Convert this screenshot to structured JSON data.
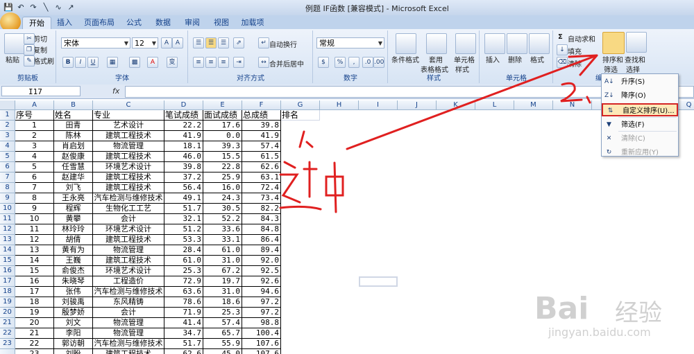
{
  "window": {
    "title": "例题 IF函数 [兼容模式] - Microsoft Excel",
    "qat_icons": [
      "save-icon",
      "undo-icon",
      "redo-icon",
      "line-icon",
      "zigzag-icon",
      "arrow-icon"
    ]
  },
  "tabs": [
    "开始",
    "插入",
    "页面布局",
    "公式",
    "数据",
    "审阅",
    "视图",
    "加载项"
  ],
  "ribbon": {
    "clipboard": {
      "paste": "粘贴",
      "cut": "剪切",
      "copy": "复制",
      "format_painter": "格式刷",
      "label": "剪贴板"
    },
    "font": {
      "name": "宋体",
      "size": "12",
      "bold": "B",
      "italic": "I",
      "underline": "U",
      "color_a": "A",
      "wen": "变",
      "label": "字体"
    },
    "alignment": {
      "wrap": "自动换行",
      "merge": "合并后居中",
      "label": "对齐方式"
    },
    "number": {
      "format": "常规",
      "currency": "%",
      "comma": ",",
      "label": "数字"
    },
    "styles": {
      "cond": "条件格式",
      "table1": "套用",
      "table2": "表格格式",
      "cell1": "单元格",
      "cell2": "样式",
      "label": "样式"
    },
    "cells": {
      "insert": "插入",
      "delete": "删除",
      "format": "格式",
      "label": "单元格"
    },
    "editing": {
      "autosum": "自动求和",
      "fill": "填充",
      "clear": "清除",
      "sort1": "排序和",
      "sort2": "筛选",
      "find1": "查找和",
      "find2": "选择",
      "label": "编"
    }
  },
  "formula_bar": {
    "cell_ref": "I17",
    "fx": "fx",
    "formula": ""
  },
  "columns": [
    "A",
    "B",
    "C",
    "D",
    "E",
    "F",
    "G",
    "H",
    "I",
    "J",
    "K",
    "L",
    "M",
    "N",
    "O",
    "P",
    "Q"
  ],
  "headers": [
    "序号",
    "姓名",
    "专业",
    "笔试成绩",
    "面试成绩",
    "总成绩",
    "排名"
  ],
  "rows": [
    [
      "1",
      "田青",
      "艺术设计",
      "22.2",
      "17.6",
      "39.8"
    ],
    [
      "2",
      "陈林",
      "建筑工程技术",
      "41.9",
      "0.0",
      "41.9"
    ],
    [
      "3",
      "肖启划",
      "物流管理",
      "18.1",
      "39.3",
      "57.4"
    ],
    [
      "4",
      "赵俊康",
      "建筑工程技术",
      "46.0",
      "15.5",
      "61.5"
    ],
    [
      "5",
      "任雪慧",
      "环境艺术设计",
      "39.8",
      "22.8",
      "62.6"
    ],
    [
      "6",
      "赵建华",
      "建筑工程技术",
      "37.2",
      "25.9",
      "63.1"
    ],
    [
      "7",
      "刘飞",
      "建筑工程技术",
      "56.4",
      "16.0",
      "72.4"
    ],
    [
      "8",
      "王永亮",
      "汽车检测与维修技术",
      "49.1",
      "24.3",
      "73.4"
    ],
    [
      "9",
      "程辉",
      "生物化工工艺",
      "51.7",
      "30.5",
      "82.2"
    ],
    [
      "10",
      "黄攀",
      "会计",
      "32.1",
      "52.2",
      "84.3"
    ],
    [
      "11",
      "林玲玲",
      "环境艺术设计",
      "51.2",
      "33.6",
      "84.8"
    ],
    [
      "12",
      "胡倩",
      "建筑工程技术",
      "53.3",
      "33.1",
      "86.4"
    ],
    [
      "13",
      "黄有为",
      "物流管理",
      "28.4",
      "61.0",
      "89.4"
    ],
    [
      "14",
      "王巍",
      "建筑工程技术",
      "61.0",
      "31.0",
      "92.0"
    ],
    [
      "15",
      "俞俊杰",
      "环境艺术设计",
      "25.3",
      "67.2",
      "92.5"
    ],
    [
      "16",
      "朱晓琴",
      "工程造价",
      "72.9",
      "19.7",
      "92.6"
    ],
    [
      "17",
      "张伟",
      "汽车检测与维修技术",
      "63.6",
      "31.0",
      "94.6"
    ],
    [
      "18",
      "刘骏禹",
      "东风精铸",
      "78.6",
      "18.6",
      "97.2"
    ],
    [
      "19",
      "殷梦娇",
      "会计",
      "71.9",
      "25.3",
      "97.2"
    ],
    [
      "20",
      "刘文",
      "物流管理",
      "41.4",
      "57.4",
      "98.8"
    ],
    [
      "21",
      "李阳",
      "物流管理",
      "34.7",
      "65.7",
      "100.4"
    ],
    [
      "22",
      "郭访朝",
      "汽车检测与维修技术",
      "51.7",
      "55.9",
      "107.6"
    ],
    [
      "23",
      "刘盼",
      "建筑工程技术",
      "62.6",
      "45.0",
      "107.6"
    ]
  ],
  "row_numbers": [
    "1",
    "2",
    "3",
    "4",
    "5",
    "6",
    "7",
    "8",
    "9",
    "10",
    "11",
    "12",
    "13",
    "14",
    "15",
    "16",
    "17",
    "18",
    "19",
    "20",
    "21",
    "22",
    "23"
  ],
  "sort_menu": {
    "items": [
      {
        "icon": "sort-asc-icon",
        "label": "升序(S)",
        "enabled": true
      },
      {
        "icon": "sort-desc-icon",
        "label": "降序(O)",
        "enabled": true
      },
      {
        "icon": "custom-sort-icon",
        "label": "自定义排序(U)...",
        "enabled": true,
        "selected": true
      },
      {
        "icon": "filter-icon",
        "label": "筛选(F)",
        "enabled": true
      },
      {
        "icon": "clear-filter-icon",
        "label": "清除(C)",
        "enabled": false
      },
      {
        "icon": "reapply-icon",
        "label": "重新应用(Y)",
        "enabled": false
      }
    ]
  },
  "annotations": {
    "step1_number": "1、",
    "step1_text": "选中",
    "step2_number": "2、",
    "color": "#e02020"
  },
  "watermark": {
    "brand": "Bai",
    "brand2": "经验",
    "site": "jingyan.baidu.com"
  }
}
